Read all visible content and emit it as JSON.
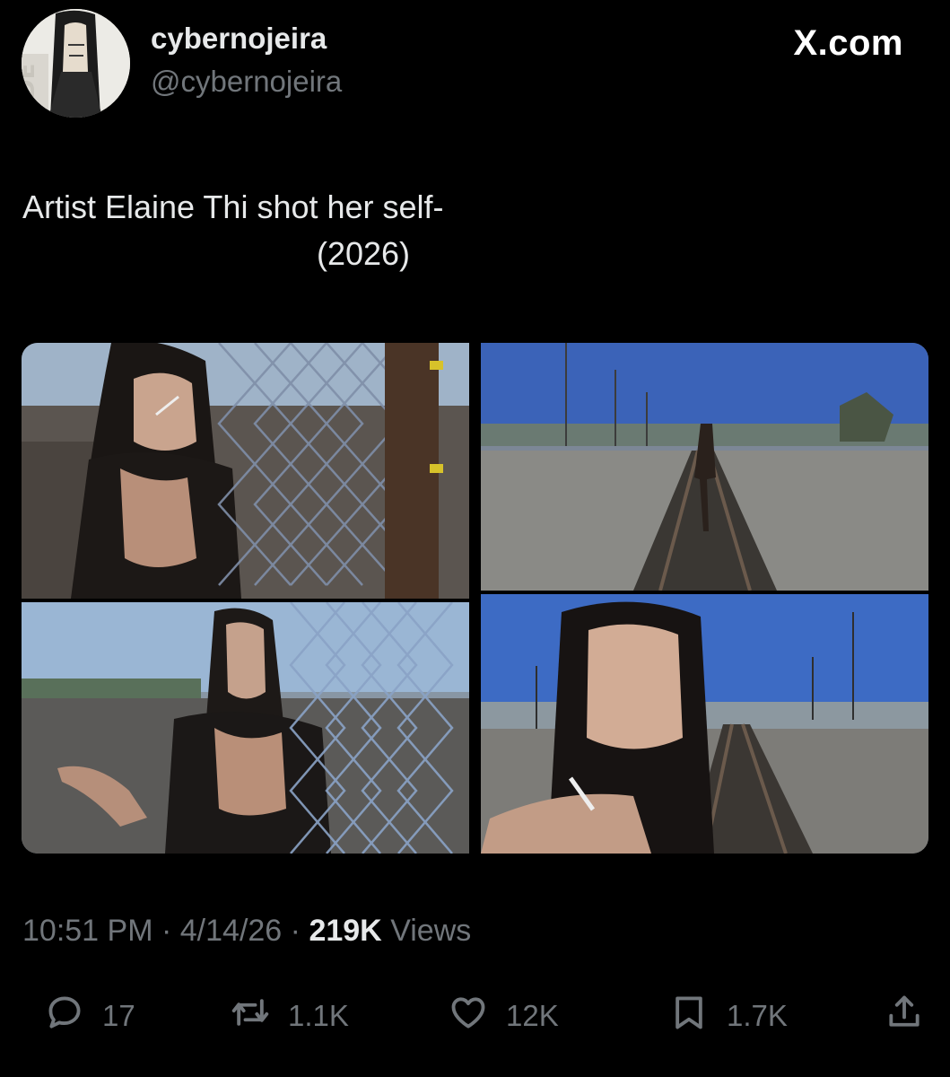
{
  "author": {
    "display_name": "cybernojeira",
    "handle": "@cybernojeira"
  },
  "brand": "X.com",
  "tweet": {
    "text_line1": "Artist Elaine Thi shot her self-",
    "text_line2": "(2026)"
  },
  "media": {
    "photos": [
      {
        "name": "photo-chainlink-fence-smoking"
      },
      {
        "name": "photo-railroad-tracks-walking"
      },
      {
        "name": "photo-fence-smoking-seated"
      },
      {
        "name": "photo-railroad-portrait-cigarette"
      }
    ]
  },
  "meta": {
    "time": "10:51 PM",
    "date": "4/14/26",
    "views_count": "219K",
    "views_label": "Views",
    "separator": "·"
  },
  "actions": {
    "reply": {
      "icon": "reply-icon",
      "count": "17"
    },
    "repost": {
      "icon": "repost-icon",
      "count": "1.1K"
    },
    "like": {
      "icon": "heart-icon",
      "count": "12K"
    },
    "bookmark": {
      "icon": "bookmark-icon",
      "count": "1.7K"
    },
    "share": {
      "icon": "share-icon"
    }
  },
  "colors": {
    "background": "#000000",
    "text_primary": "#e7e9ea",
    "text_secondary": "#71767b"
  }
}
